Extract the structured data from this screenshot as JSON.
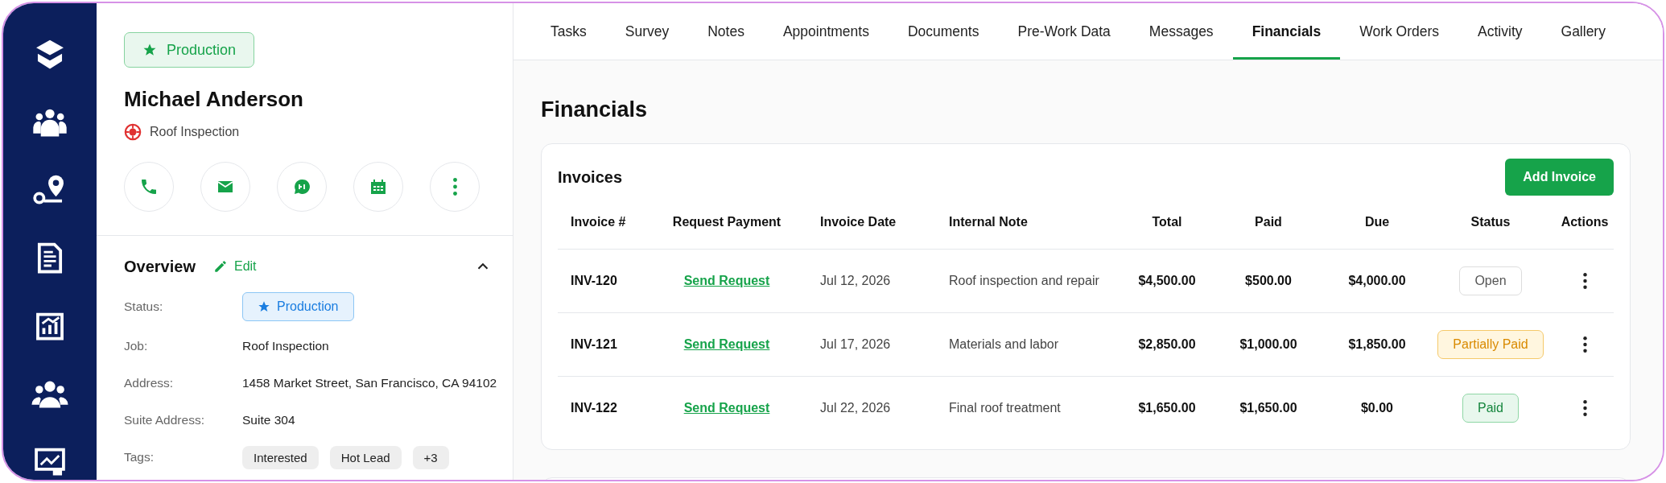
{
  "stage_badge": {
    "label": "Production"
  },
  "contact": {
    "name": "Michael Anderson",
    "job": "Roof Inspection"
  },
  "overview": {
    "title": "Overview",
    "edit": "Edit",
    "expanded": true,
    "fields": [
      {
        "label": "Status:",
        "kind": "badge",
        "value": "Production"
      },
      {
        "label": "Job:",
        "kind": "text",
        "value": "Roof Inspection"
      },
      {
        "label": "Address:",
        "kind": "text",
        "value": "1458 Market Street, San Francisco, CA 94102"
      },
      {
        "label": "Suite Address:",
        "kind": "text",
        "value": "Suite 304"
      },
      {
        "label": "Tags:",
        "kind": "tags",
        "tags": [
          "Interested",
          "Hot Lead",
          "+3"
        ]
      }
    ]
  },
  "tabs": [
    {
      "label": "Tasks",
      "selected": false
    },
    {
      "label": "Survey",
      "selected": false
    },
    {
      "label": "Notes",
      "selected": false
    },
    {
      "label": "Appointments",
      "selected": false
    },
    {
      "label": "Documents",
      "selected": false
    },
    {
      "label": "Pre-Work Data",
      "selected": false
    },
    {
      "label": "Messages",
      "selected": false
    },
    {
      "label": "Financials",
      "selected": true
    },
    {
      "label": "Work Orders",
      "selected": false
    },
    {
      "label": "Activity",
      "selected": false
    },
    {
      "label": "Gallery",
      "selected": false
    }
  ],
  "page_title": "Financials",
  "invoices": {
    "title": "Invoices",
    "add_button": "Add Invoice",
    "columns": [
      "Invoice #",
      "Request Payment",
      "Invoice Date",
      "Internal Note",
      "Total",
      "Paid",
      "Due",
      "Status",
      "Actions"
    ],
    "rows": [
      {
        "invoice": "INV-120",
        "request": "Send Request",
        "date": "Jul 12, 2026",
        "note": "Roof inspection and repair",
        "total": "$4,500.00",
        "paid": "$500.00",
        "due": "$4,000.00",
        "status": "Open",
        "kind": "open"
      },
      {
        "invoice": "INV-121",
        "request": "Send Request",
        "date": "Jul 17, 2026",
        "note": "Materials and labor",
        "total": "$2,850.00",
        "paid": "$1,000.00",
        "due": "$1,850.00",
        "status": "Partially Paid",
        "kind": "partial"
      },
      {
        "invoice": "INV-122",
        "request": "Send Request",
        "date": "Jul 22, 2026",
        "note": "Final roof treatment",
        "total": "$1,650.00",
        "paid": "$1,650.00",
        "due": "$0.00",
        "status": "Paid",
        "kind": "paid"
      }
    ]
  }
}
